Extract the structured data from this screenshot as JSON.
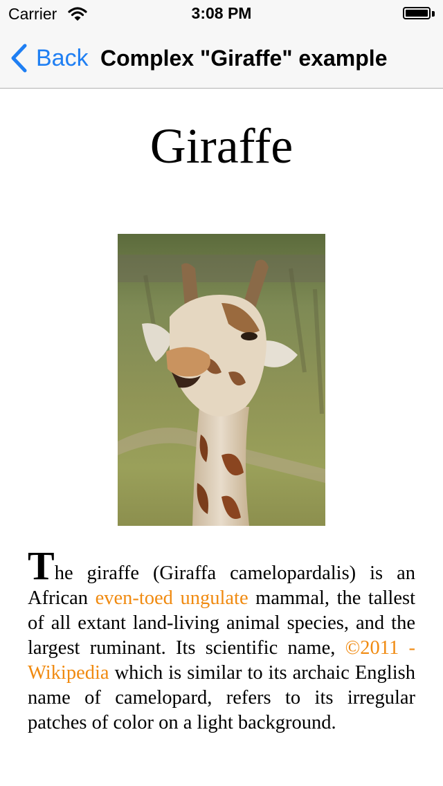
{
  "status_bar": {
    "carrier": "Carrier",
    "time": "3:08 PM",
    "wifi_icon": "wifi-icon",
    "battery_icon": "battery-full-icon"
  },
  "nav_bar": {
    "back_label": "Back",
    "back_icon": "chevron-left-icon",
    "title": "Complex \"Giraffe\" example"
  },
  "content": {
    "title": "Giraffe",
    "image_subject": "giraffe",
    "article": {
      "drop_cap": "T",
      "text_1": "he giraffe (Giraffa camelopardalis) is an African ",
      "link_1": "even-toed ungulate",
      "text_2": " mammal, the tallest of all extant land-living animal species, and the largest ruminant. Its scientific name, ",
      "link_2": "©2011 - Wikipedia",
      "text_3": " which is similar to its archaic English name of camelopard, refers to its irregular patches of color on a light background."
    }
  },
  "colors": {
    "accent": "#1f7ff3",
    "link": "#f08a10",
    "bar_background": "#f7f7f7"
  }
}
